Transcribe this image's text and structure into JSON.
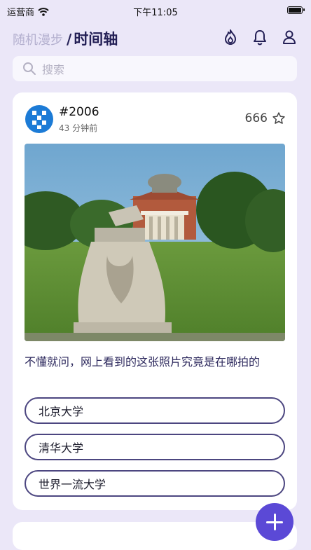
{
  "status_bar": {
    "carrier": "运营商",
    "time": "下午11:05"
  },
  "nav": {
    "tab_random": "随机漫步",
    "separator": "/",
    "tab_timeline": "时间轴",
    "icons": [
      "fire-icon",
      "bell-icon",
      "user-icon"
    ]
  },
  "search": {
    "placeholder": "搜索",
    "icon": "search-icon"
  },
  "post": {
    "id": "#2006",
    "time": "43 分钟前",
    "likes": "666",
    "like_icon": "star-icon",
    "question": "不懂就问，网上看到的这张照片究竟是在哪拍的",
    "options": [
      "北京大学",
      "清华大学",
      "世界一流大学"
    ]
  },
  "fab": {
    "icon": "plus-icon"
  },
  "colors": {
    "background": "#ebe7f8",
    "accent": "#5b49d6",
    "title": "#242056",
    "option_border": "#4c4680",
    "avatar": "#1c7bd6"
  }
}
